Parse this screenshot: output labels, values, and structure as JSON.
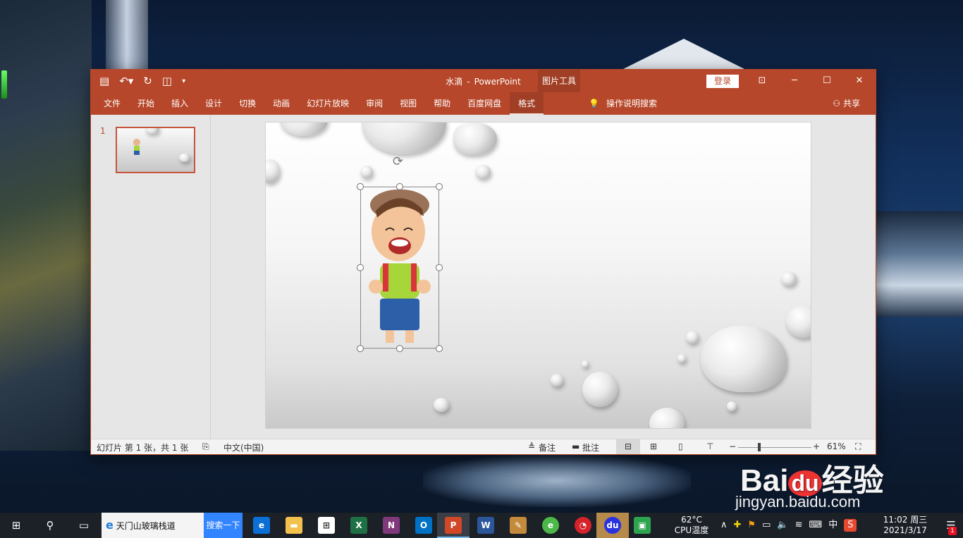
{
  "window": {
    "title_doc": "水滴",
    "title_sep": "-",
    "title_app": "PowerPoint",
    "tools_tab": "图片工具",
    "login_label": "登录",
    "qat": {
      "save_icon": "save-icon",
      "undo_icon": "undo-icon",
      "redo_icon": "redo-icon",
      "present_icon": "present-icon"
    }
  },
  "ribbon": {
    "tabs": [
      "文件",
      "开始",
      "插入",
      "设计",
      "切换",
      "动画",
      "幻灯片放映",
      "审阅",
      "视图",
      "帮助",
      "百度网盘",
      "格式"
    ],
    "active_tab": "格式",
    "tell_me": "操作说明搜索",
    "share": "共享"
  },
  "thumbnails": {
    "slide_number": "1"
  },
  "status": {
    "slide_info": "幻灯片 第 1 张，共 1 张",
    "language": "中文(中国)",
    "notes": "备注",
    "comments": "批注",
    "zoom": "61%"
  },
  "watermark": {
    "brand": "Bai",
    "brand_du": "du",
    "product": "经验",
    "url": "jingyan.baidu.com"
  },
  "taskbar": {
    "search_text": "天门山玻璃栈道",
    "search_button": "搜索一下",
    "apps": [
      "edge",
      "file-explorer",
      "store",
      "excel",
      "onenote",
      "outlook",
      "powerpoint",
      "word",
      "paint",
      "browser-360",
      "netease",
      "baidu",
      "app-green"
    ],
    "cpu_temp": "62°C",
    "cpu_label": "CPU温度",
    "ime": "中",
    "time": "11:02 周三",
    "date": "2021/3/17",
    "notification_count": "1"
  },
  "colors": {
    "accent": "#b7472a",
    "accent_dark": "#a03f25",
    "taskbar": "#1c2027",
    "baidu_blue": "#3385ff"
  }
}
